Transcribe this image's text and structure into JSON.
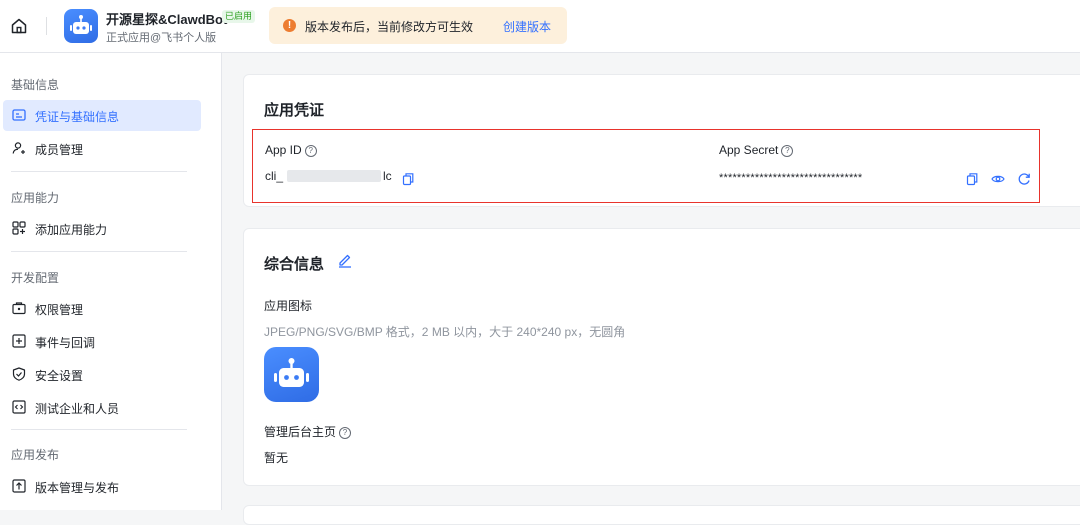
{
  "topbar": {
    "app_name": "开源星探&ClawdBot",
    "app_status_badge": "已启用",
    "app_subtitle": "正式应用@飞书个人版",
    "notice_icon": "!",
    "notice_text": "版本发布后，当前修改方可生效",
    "notice_link": "创建版本"
  },
  "sidebar": {
    "sections": [
      {
        "title": "基础信息",
        "items": [
          {
            "label": "凭证与基础信息",
            "icon": "credential-icon",
            "active": true
          },
          {
            "label": "成员管理",
            "icon": "member-add-icon",
            "active": false
          }
        ]
      },
      {
        "title": "应用能力",
        "items": [
          {
            "label": "添加应用能力",
            "icon": "grid-add-icon",
            "active": false
          }
        ]
      },
      {
        "title": "开发配置",
        "items": [
          {
            "label": "权限管理",
            "icon": "permission-box-icon",
            "active": false
          },
          {
            "label": "事件与回调",
            "icon": "event-plus-icon",
            "active": false
          },
          {
            "label": "安全设置",
            "icon": "shield-icon",
            "active": false
          },
          {
            "label": "测试企业和人员",
            "icon": "code-box-icon",
            "active": false
          }
        ]
      },
      {
        "title": "应用发布",
        "items": [
          {
            "label": "版本管理与发布",
            "icon": "upload-box-icon",
            "active": false
          }
        ]
      }
    ]
  },
  "credentials": {
    "title": "应用凭证",
    "app_id_label": "App ID",
    "app_id_prefix": "cli_",
    "app_id_suffix": "lc",
    "app_secret_label": "App Secret",
    "app_secret_value": "********************************"
  },
  "general": {
    "title": "综合信息",
    "icon_label": "应用图标",
    "icon_hint": "JPEG/PNG/SVG/BMP 格式，2 MB 以内，大于 240*240 px，无圆角",
    "homepage_label": "管理后台主页",
    "homepage_value": "暂无"
  },
  "colors": {
    "accent": "#3370ff",
    "highlight_border": "#e8332c",
    "notice_bg": "#fdf0dc",
    "badge_green": "#2ea121"
  }
}
